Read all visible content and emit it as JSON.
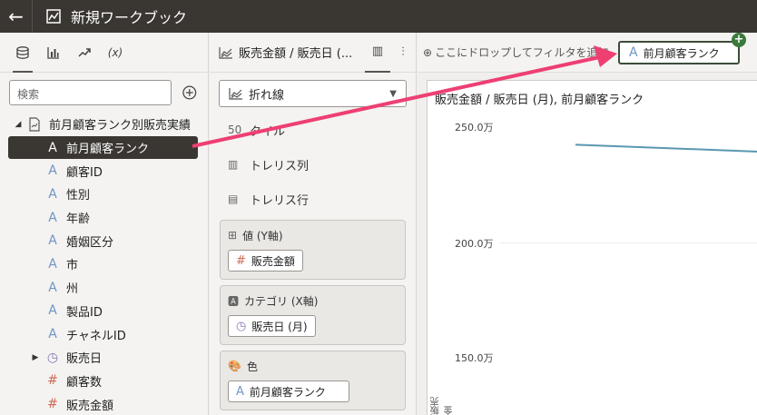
{
  "app": {
    "title": "新規ワークブック"
  },
  "left_panel": {
    "tabs": [
      {
        "name": "data-tab-icon",
        "glyph": "🗄"
      },
      {
        "name": "visualizations-tab-icon",
        "glyph": "📊"
      },
      {
        "name": "analytics-tab-icon",
        "glyph": "↗"
      },
      {
        "name": "calculations-tab-icon",
        "glyph": "(x)"
      }
    ],
    "search_placeholder": "検索",
    "dataset": {
      "name": "前月顧客ランク別販売実績"
    },
    "items": [
      {
        "label": "前月顧客ランク",
        "type": "attribute",
        "selected": true
      },
      {
        "label": "顧客ID",
        "type": "attribute"
      },
      {
        "label": "性別",
        "type": "attribute"
      },
      {
        "label": "年齢",
        "type": "attribute"
      },
      {
        "label": "婚姻区分",
        "type": "attribute"
      },
      {
        "label": "市",
        "type": "attribute"
      },
      {
        "label": "州",
        "type": "attribute"
      },
      {
        "label": "製品ID",
        "type": "attribute"
      },
      {
        "label": "チャネルID",
        "type": "attribute"
      },
      {
        "label": "販売日",
        "type": "time"
      },
      {
        "label": "顧客数",
        "type": "measure"
      },
      {
        "label": "販売金額",
        "type": "measure"
      }
    ]
  },
  "mid_panel": {
    "header_title": "販売金額 / 販売日 (...",
    "chart_type": "折れ線",
    "properties": [
      "タイル",
      "トレリス列",
      "トレリス行"
    ],
    "values_box": {
      "title": "値 (Y軸)",
      "pill": "販売金額"
    },
    "category_box": {
      "title": "カテゴリ (X軸)",
      "pill": "販売日 (月)"
    },
    "color_box": {
      "title": "色",
      "pill": "前月顧客ランク"
    }
  },
  "filter_bar": {
    "drop_text": "ここにドロップしてフィルタを追加",
    "dragging_pill": "前月顧客ランク",
    "plus": "+"
  },
  "chart": {
    "title": "販売金額 / 販売日 (月), 前月顧客ランク",
    "ylabel": "販売金"
  },
  "chart_data": {
    "type": "line",
    "title": "販売金額 / 販売日 (月), 前月顧客ランク",
    "ylabel": "販売金",
    "yticks": [
      "250.0万",
      "200.0万",
      "150.0万"
    ],
    "ytick_values": [
      2500000,
      2000000,
      1500000
    ],
    "series": [
      {
        "values": [
          2420000,
          2390000
        ]
      }
    ],
    "colors": {
      "series1": "#5b97b1"
    }
  },
  "colors": {
    "topbar": "#3a3632",
    "selected": "#3a3632",
    "arrow": "#ee3f73",
    "accent_green": "#3b7a3b"
  }
}
